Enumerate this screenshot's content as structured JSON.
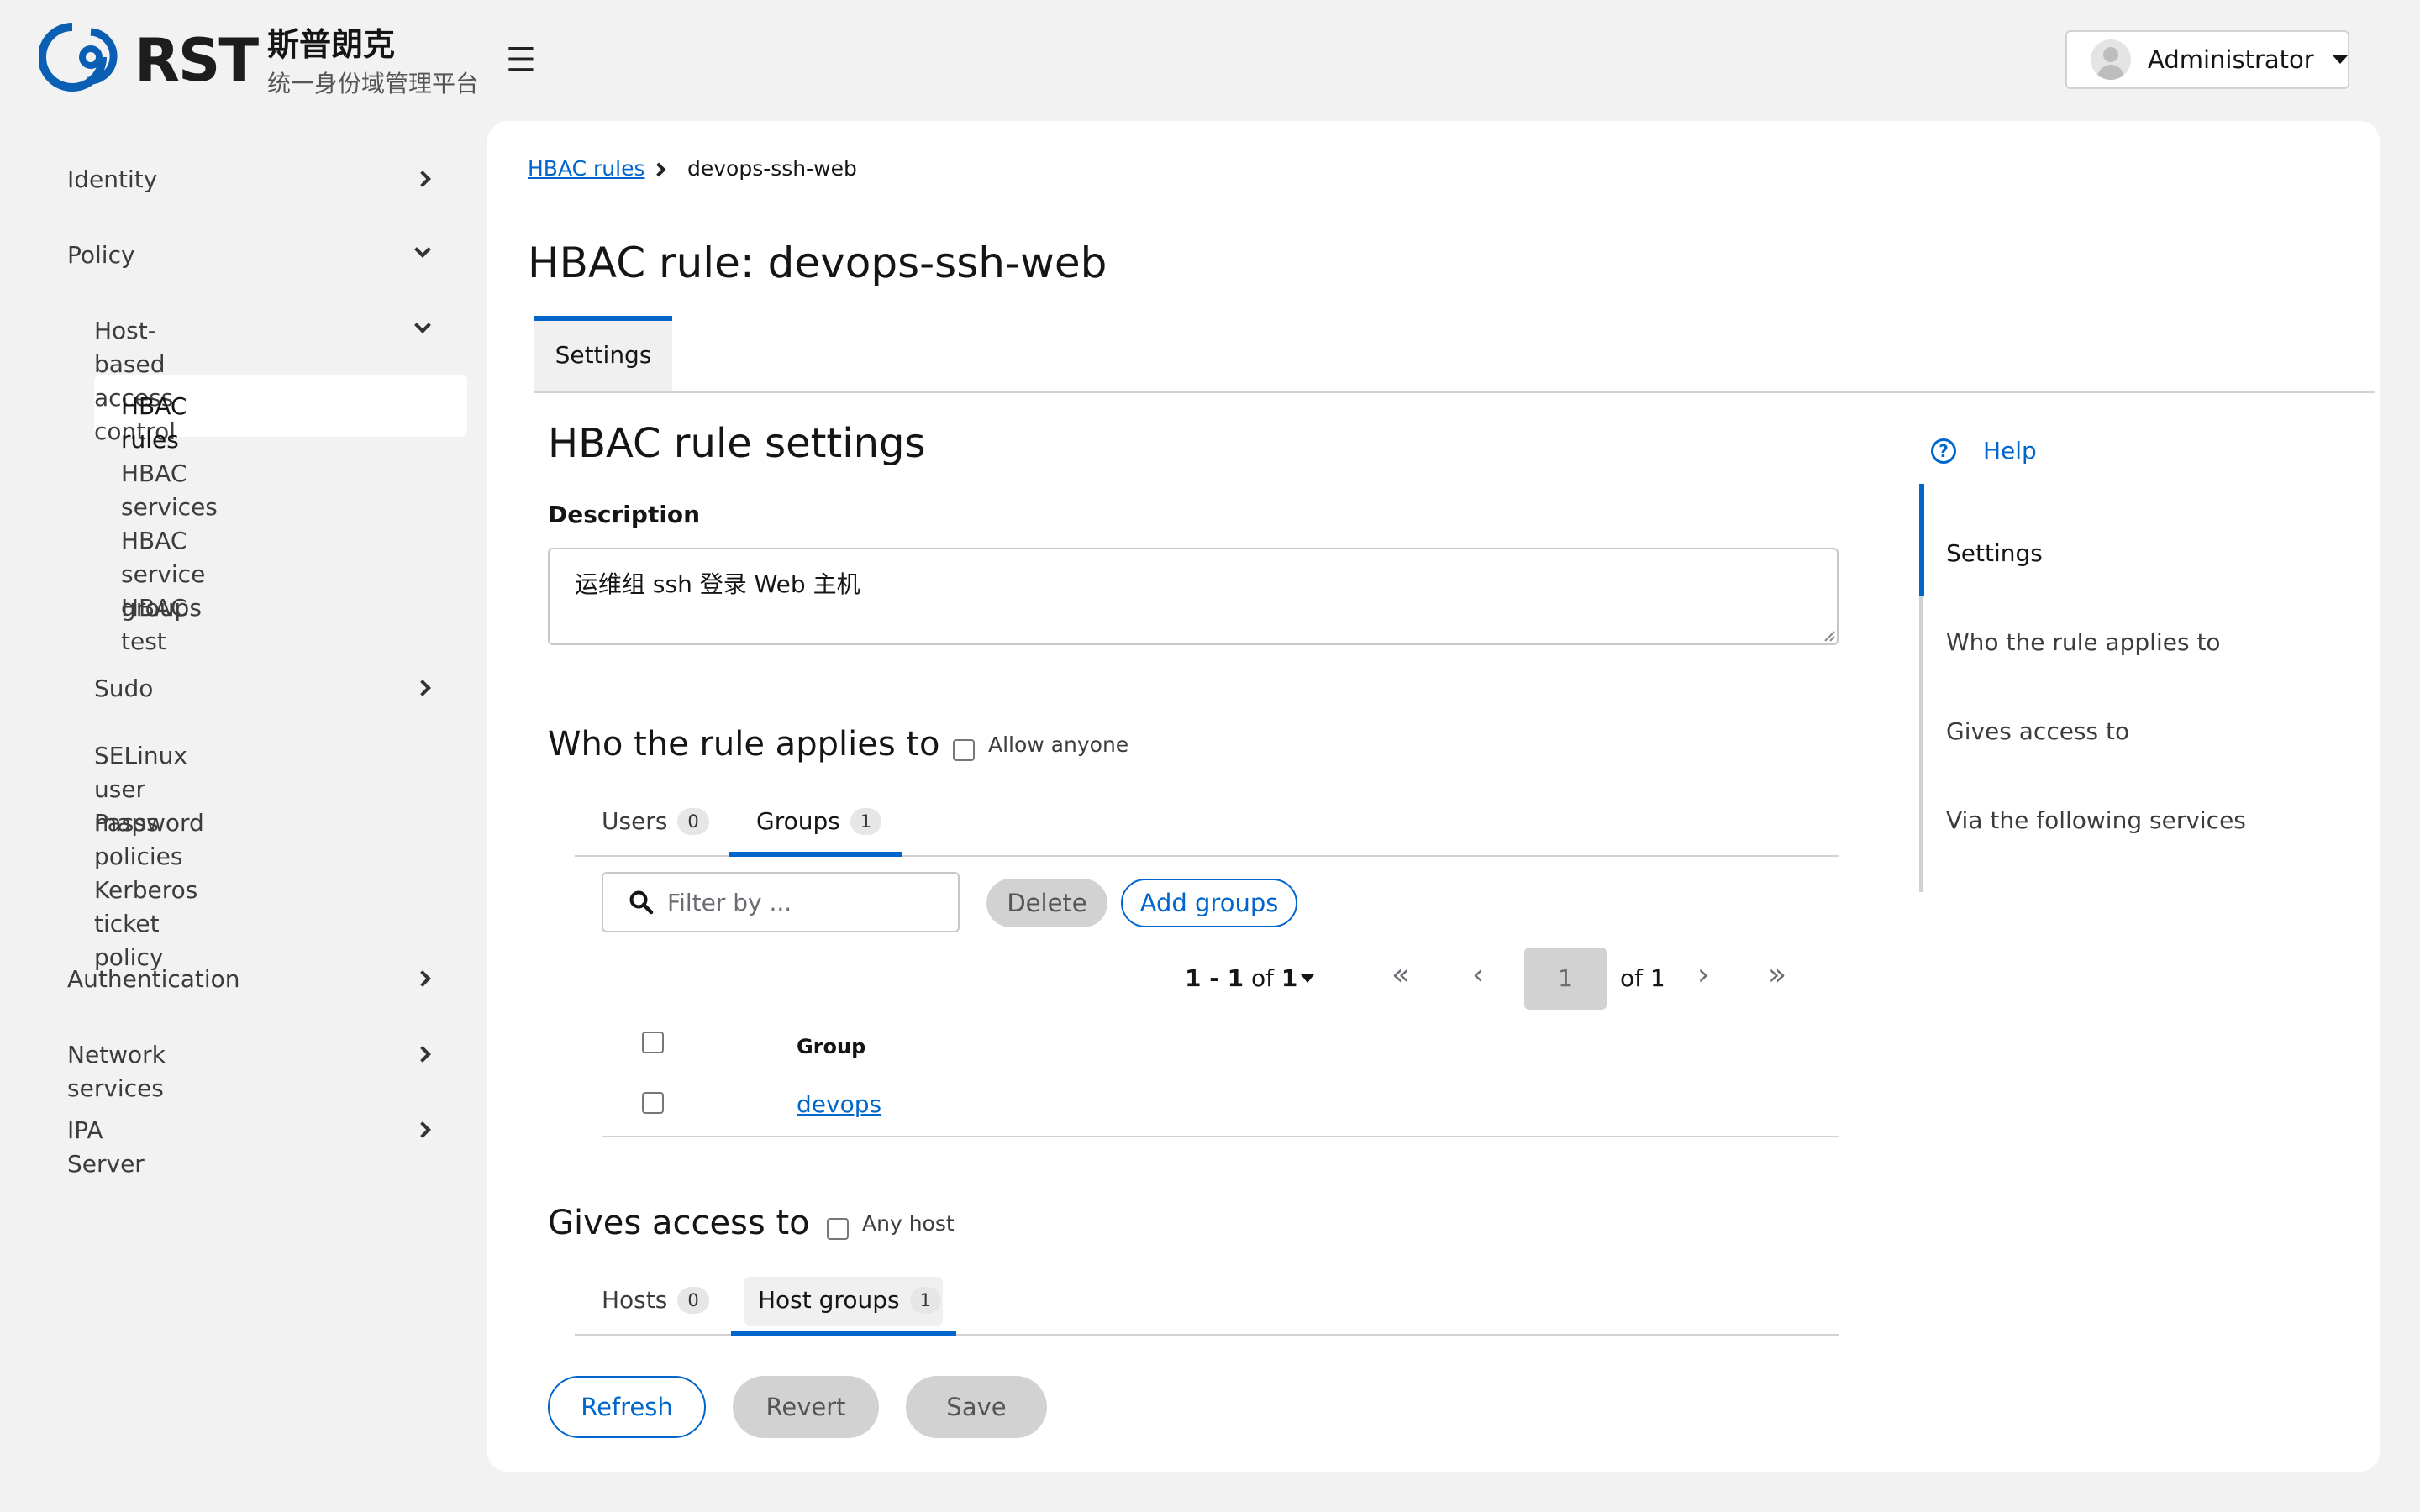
{
  "brand": {
    "mark": "RST",
    "name_cn": "斯普朗克",
    "subtitle_cn": "统一身份域管理平台"
  },
  "header": {
    "menu_icon": "hamburger-icon",
    "user": "Administrator"
  },
  "sidebar": {
    "identity": "Identity",
    "policy": "Policy",
    "hbac": "Host-based access control",
    "hbac_rules": "HBAC rules",
    "hbac_services": "HBAC services",
    "hbac_service_groups": "HBAC service groups",
    "hbac_test": "HBAC test",
    "sudo": "Sudo",
    "selinux": "SELinux user maps",
    "password_policies": "Password policies",
    "kerberos": "Kerberos ticket policy",
    "authentication": "Authentication",
    "network_services": "Network services",
    "ipa_server": "IPA Server"
  },
  "breadcrumb": {
    "parent": "HBAC rules",
    "current": "devops-ssh-web"
  },
  "page": {
    "title": "HBAC rule: devops-ssh-web",
    "tab": "Settings"
  },
  "settings": {
    "title": "HBAC rule settings",
    "description_label": "Description",
    "description_value": "运维组 ssh 登录 Web 主机"
  },
  "who": {
    "title": "Who the rule applies to",
    "allow_anyone": "Allow anyone",
    "tabs": [
      {
        "label": "Users",
        "count": "0"
      },
      {
        "label": "Groups",
        "count": "1"
      }
    ],
    "active_tab": "Groups",
    "search_placeholder": "Filter by ...",
    "delete": "Delete",
    "add": "Add groups",
    "pagination": {
      "range": "1 - 1",
      "of_label": "of",
      "total": "1",
      "page": "1",
      "page_of": "of 1"
    },
    "column": "Group",
    "rows": [
      "devops"
    ]
  },
  "gives": {
    "title": "Gives access to",
    "any_host": "Any host",
    "tabs": [
      {
        "label": "Hosts",
        "count": "0"
      },
      {
        "label": "Host groups",
        "count": "1"
      }
    ],
    "active_tab": "Host groups"
  },
  "actions": {
    "refresh": "Refresh",
    "revert": "Revert",
    "save": "Save"
  },
  "jump": {
    "help": "Help",
    "items": [
      "Settings",
      "Who the rule applies to",
      "Gives access to",
      "Via the following services"
    ],
    "active": "Settings"
  },
  "colors": {
    "accent": "#0066cc",
    "background": "#f2f2f2",
    "panel": "#ffffff",
    "button_grey": "#d2d2d2"
  }
}
